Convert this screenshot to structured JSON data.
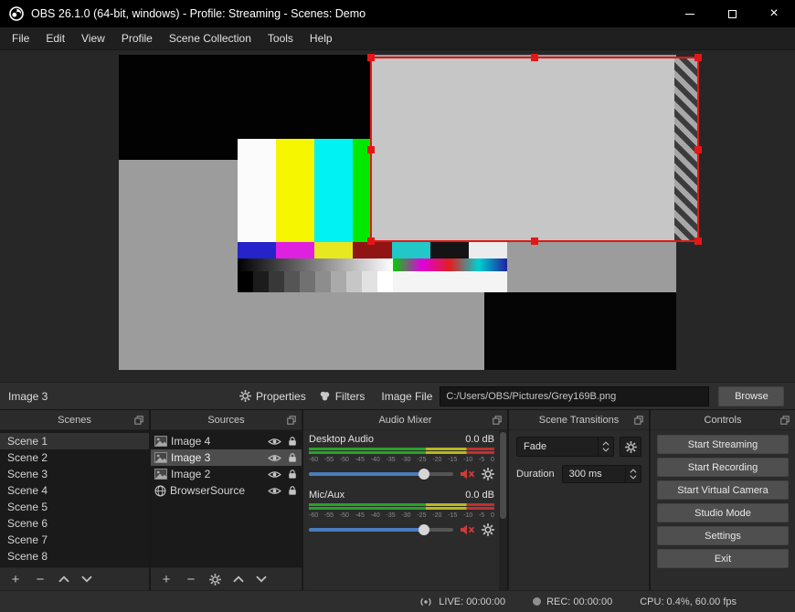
{
  "window": {
    "title": "OBS 26.1.0 (64-bit, windows) - Profile: Streaming - Scenes: Demo"
  },
  "icons": {
    "plus": "+",
    "minus": "−",
    "close": "×"
  },
  "menu": {
    "items": [
      "File",
      "Edit",
      "View",
      "Profile",
      "Scene Collection",
      "Tools",
      "Help"
    ]
  },
  "source_toolbar": {
    "selected_source": "Image 3",
    "properties": "Properties",
    "filters": "Filters",
    "image_file_label": "Image File",
    "image_file_path": "C:/Users/OBS/Pictures/Grey169B.png",
    "browse": "Browse"
  },
  "scenes_panel": {
    "title": "Scenes",
    "selected_index": 0,
    "items": [
      "Scene 1",
      "Scene 2",
      "Scene 3",
      "Scene 4",
      "Scene 5",
      "Scene 6",
      "Scene 7",
      "Scene 8"
    ]
  },
  "sources_panel": {
    "title": "Sources",
    "items": [
      {
        "name": "Image 4",
        "icon": "image-icon",
        "selected": false
      },
      {
        "name": "Image 3",
        "icon": "image-icon",
        "selected": true
      },
      {
        "name": "Image 2",
        "icon": "image-icon",
        "selected": false
      },
      {
        "name": "BrowserSource",
        "icon": "globe-icon",
        "selected": false
      }
    ]
  },
  "audio_mixer": {
    "title": "Audio Mixer",
    "scale_ticks": [
      "-60",
      "-55",
      "-50",
      "-45",
      "-40",
      "-35",
      "-30",
      "-25",
      "-20",
      "-15",
      "-10",
      "-5",
      "0"
    ],
    "channels": [
      {
        "name": "Desktop Audio",
        "level_db": "0.0 dB",
        "muted": true,
        "slider_percent": 80
      },
      {
        "name": "Mic/Aux",
        "level_db": "0.0 dB",
        "muted": true,
        "slider_percent": 80
      }
    ]
  },
  "transitions_panel": {
    "title": "Scene Transitions",
    "current_transition": "Fade",
    "duration_label": "Duration",
    "duration_value": "300 ms"
  },
  "controls_panel": {
    "title": "Controls",
    "buttons": [
      "Start Streaming",
      "Start Recording",
      "Start Virtual Camera",
      "Studio Mode",
      "Settings",
      "Exit"
    ]
  },
  "status_bar": {
    "live": "LIVE: 00:00:00",
    "rec": "REC: 00:00:00",
    "cpu": "CPU: 0.4%, 60.00 fps"
  },
  "colors": {
    "accent_blue": "#4a7dbd",
    "selection_red": "#e41717",
    "meter_green": "#2aa02a",
    "meter_yellow": "#b8b820",
    "meter_red": "#c03030",
    "mute_red": "#cf3a3a"
  }
}
